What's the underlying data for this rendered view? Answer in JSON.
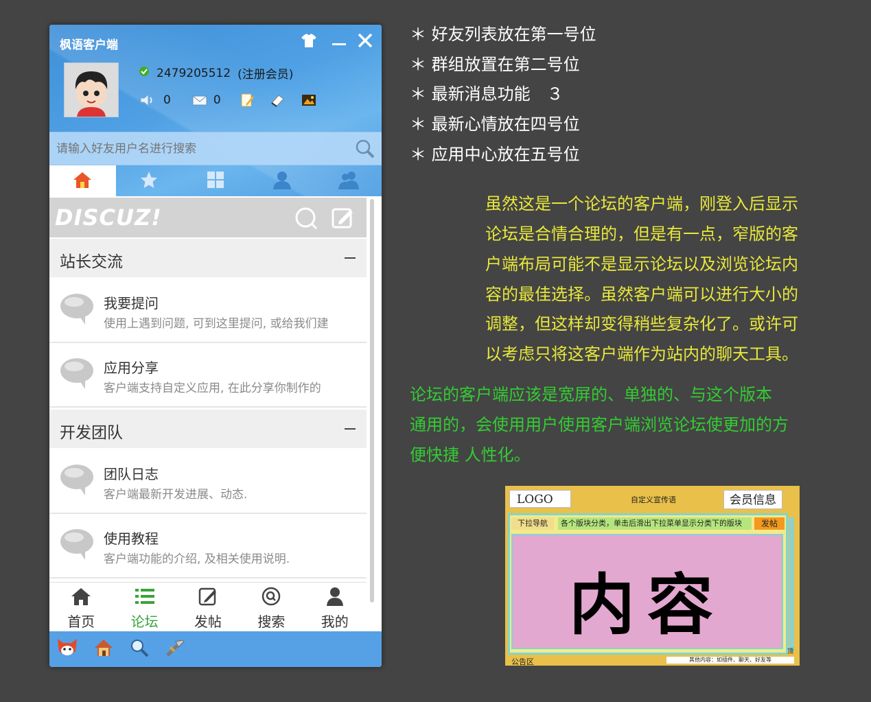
{
  "client": {
    "title": "枫语客户端",
    "user": {
      "id": "2479205512",
      "role": "(注册会员)",
      "notices": "0",
      "messages": "0"
    },
    "search": {
      "placeholder": "请输入好友用户名进行搜索"
    },
    "tabs": [
      {
        "icon": "home-icon",
        "active": true
      },
      {
        "icon": "star-icon",
        "active": false
      },
      {
        "icon": "grid-icon",
        "active": false
      },
      {
        "icon": "person-icon",
        "active": false
      },
      {
        "icon": "group-icon",
        "active": false
      }
    ],
    "forum": {
      "logo": "DISCUZ!",
      "sections": [
        {
          "title": "站长交流",
          "toggle": "—",
          "items": [
            {
              "title": "我要提问",
              "desc": "使用上遇到问题, 可到这里提问, 或给我们建"
            },
            {
              "title": "应用分享",
              "desc": "客户端支持自定义应用, 在此分享你制作的"
            }
          ]
        },
        {
          "title": "开发团队",
          "toggle": "—",
          "items": [
            {
              "title": "团队日志",
              "desc": "客户端最新开发进展、动态."
            },
            {
              "title": "使用教程",
              "desc": "客户端功能的介绍, 及相关使用说明."
            }
          ]
        }
      ]
    },
    "bottom_nav": [
      {
        "label": "首页",
        "icon": "home-icon"
      },
      {
        "label": "论坛",
        "icon": "list-icon",
        "active": true
      },
      {
        "label": "发帖",
        "icon": "edit-icon"
      },
      {
        "label": "搜索",
        "icon": "search-icon"
      },
      {
        "label": "我的",
        "icon": "user-icon"
      }
    ],
    "colors": {
      "header": "#4fa0e4",
      "active_green": "#3aa33a",
      "status_bar": "#56a0e6"
    }
  },
  "notes": {
    "bullets": [
      "＊ 好友列表放在第一号位",
      "＊ 群组放置在第二号位",
      "＊ 最新消息功能　３",
      "＊ 最新心情放在四号位",
      "＊ 应用中心放在五号位"
    ],
    "yellow_lines": [
      "虽然这是一个论坛的客户端，刚登入后显示",
      "论坛是合情合理的，但是有一点，窄版的客",
      "户端布局可能不是显示论坛以及浏览论坛内",
      "容的最佳选择。虽然客户端可以进行大小的",
      "调整，但这样却变得稍些复杂化了。或许可",
      "以考虑只将这客户端作为站内的聊天工具。"
    ],
    "green_lines": [
      "论坛的客户端应该是宽屏的、单独的、与这个版本",
      "通用的，会使用用户使用客户端浏览论坛使更加的方",
      "便快捷  人性化。"
    ],
    "colors": {
      "yellow": "#e8e83c",
      "green": "#33cc33"
    }
  },
  "wireframe": {
    "logo": "LOGO",
    "slogan": "自定义宣传语",
    "member": "会员信息",
    "dropdown_nav": "下拉导航",
    "categories": "各个版块分类，单击后滑出下拉菜单显示分类下的版块",
    "post": "发帖",
    "content": "内容",
    "top": "顶",
    "notice": "公告区",
    "other": "其他内容：如插件、聊天、好友等"
  }
}
